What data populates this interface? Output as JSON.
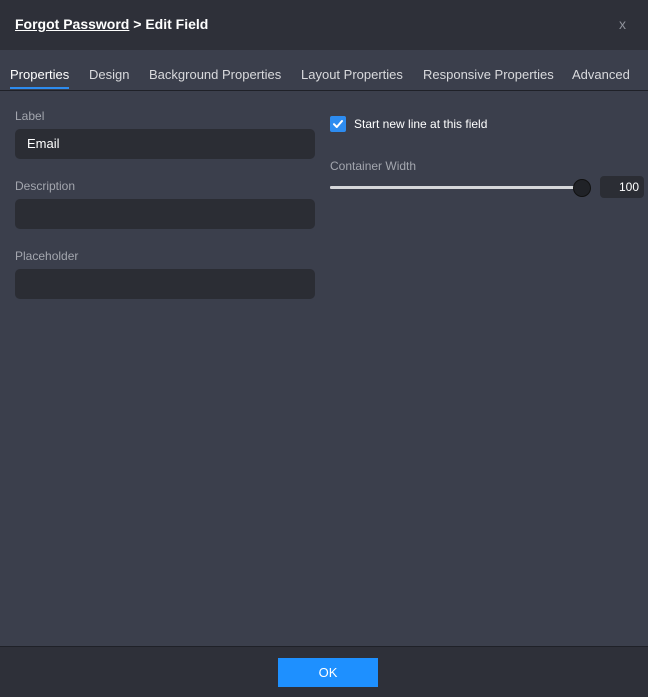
{
  "header": {
    "breadcrumb_link": "Forgot Password",
    "breadcrumb_rest": " > Edit Field",
    "close_label": "x"
  },
  "tabs": [
    {
      "label": "Properties",
      "active": true
    },
    {
      "label": "Design"
    },
    {
      "label": "Background Properties"
    },
    {
      "label": "Layout Properties"
    },
    {
      "label": "Responsive Properties"
    },
    {
      "label": "Advanced"
    }
  ],
  "form": {
    "label": {
      "title": "Label",
      "value": "Email"
    },
    "description": {
      "title": "Description",
      "value": ""
    },
    "placeholder": {
      "title": "Placeholder",
      "value": ""
    }
  },
  "options": {
    "new_line": {
      "label": "Start new line at this field",
      "checked": true
    },
    "container_width": {
      "title": "Container Width",
      "value": "100",
      "level_percent": 100
    }
  },
  "footer": {
    "ok_label": "OK"
  },
  "colors": {
    "accent": "#2d8cf0",
    "ok_button": "#1e90ff",
    "background": "#3b3f4c",
    "header": "#2e3039"
  },
  "icons": {
    "close": "close-icon",
    "checkbox": "checkmark-icon"
  }
}
